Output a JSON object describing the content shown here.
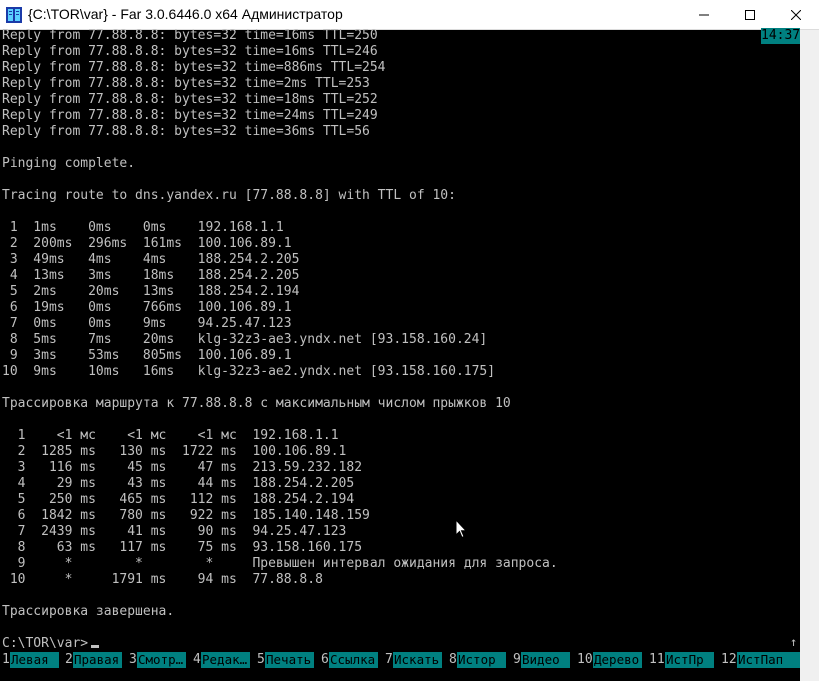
{
  "window": {
    "title": "{C:\\TOR\\var} - Far 3.0.6446.0 x64 Администратор",
    "minimize_icon": "minimize-icon",
    "maximize_icon": "maximize-icon",
    "close_icon": "close-icon"
  },
  "clock": "14:37",
  "console_lines": [
    "Reply from 77.88.8.8: bytes=32 time=16ms TTL=250",
    "Reply from 77.88.8.8: bytes=32 time=16ms TTL=246",
    "Reply from 77.88.8.8: bytes=32 time=886ms TTL=254",
    "Reply from 77.88.8.8: bytes=32 time=2ms TTL=253",
    "Reply from 77.88.8.8: bytes=32 time=18ms TTL=252",
    "Reply from 77.88.8.8: bytes=32 time=24ms TTL=249",
    "Reply from 77.88.8.8: bytes=32 time=36ms TTL=56",
    "",
    "Pinging complete.",
    "",
    "Tracing route to dns.yandex.ru [77.88.8.8] with TTL of 10:",
    "",
    " 1  1ms    0ms    0ms    192.168.1.1",
    " 2  200ms  296ms  161ms  100.106.89.1",
    " 3  49ms   4ms    4ms    188.254.2.205",
    " 4  13ms   3ms    18ms   188.254.2.205",
    " 5  2ms    20ms   13ms   188.254.2.194",
    " 6  19ms   0ms    766ms  100.106.89.1",
    " 7  0ms    0ms    9ms    94.25.47.123",
    " 8  5ms    7ms    20ms   klg-32z3-ae3.yndx.net [93.158.160.24]",
    " 9  3ms    53ms   805ms  100.106.89.1",
    "10  9ms    10ms   16ms   klg-32z3-ae2.yndx.net [93.158.160.175]",
    "",
    "Трассировка маршрута к 77.88.8.8 с максимальным числом прыжков 10",
    "",
    "  1    <1 мс    <1 мс    <1 мс  192.168.1.1",
    "  2  1285 ms   130 ms  1722 ms  100.106.89.1",
    "  3   116 ms    45 ms    47 ms  213.59.232.182",
    "  4    29 ms    43 ms    44 ms  188.254.2.205",
    "  5   250 ms   465 ms   112 ms  188.254.2.194",
    "  6  1842 ms   780 ms   922 ms  185.140.148.159",
    "  7  2439 ms    41 ms    90 ms  94.25.47.123",
    "  8    63 ms   117 ms    75 ms  93.158.160.175",
    "  9     *        *        *     Превышен интервал ожидания для запроса.",
    " 10     *     1791 ms    94 ms  77.88.8.8",
    "",
    "Трассировка завершена.",
    "",
    "C:\\TOR\\var>"
  ],
  "keybar": [
    {
      "num": "1",
      "label": "Левая"
    },
    {
      "num": "2",
      "label": "Правая"
    },
    {
      "num": "3",
      "label": "Смотр…"
    },
    {
      "num": "4",
      "label": "Редак…"
    },
    {
      "num": "5",
      "label": "Печать"
    },
    {
      "num": "6",
      "label": "Ссылка"
    },
    {
      "num": "7",
      "label": "Искать"
    },
    {
      "num": "8",
      "label": "Истор"
    },
    {
      "num": "9",
      "label": "Видео"
    },
    {
      "num": "10",
      "label": "Дерево"
    },
    {
      "num": "11",
      "label": "ИстПр"
    },
    {
      "num": "12",
      "label": "ИстПап"
    }
  ],
  "scroll_indicator": "↑"
}
